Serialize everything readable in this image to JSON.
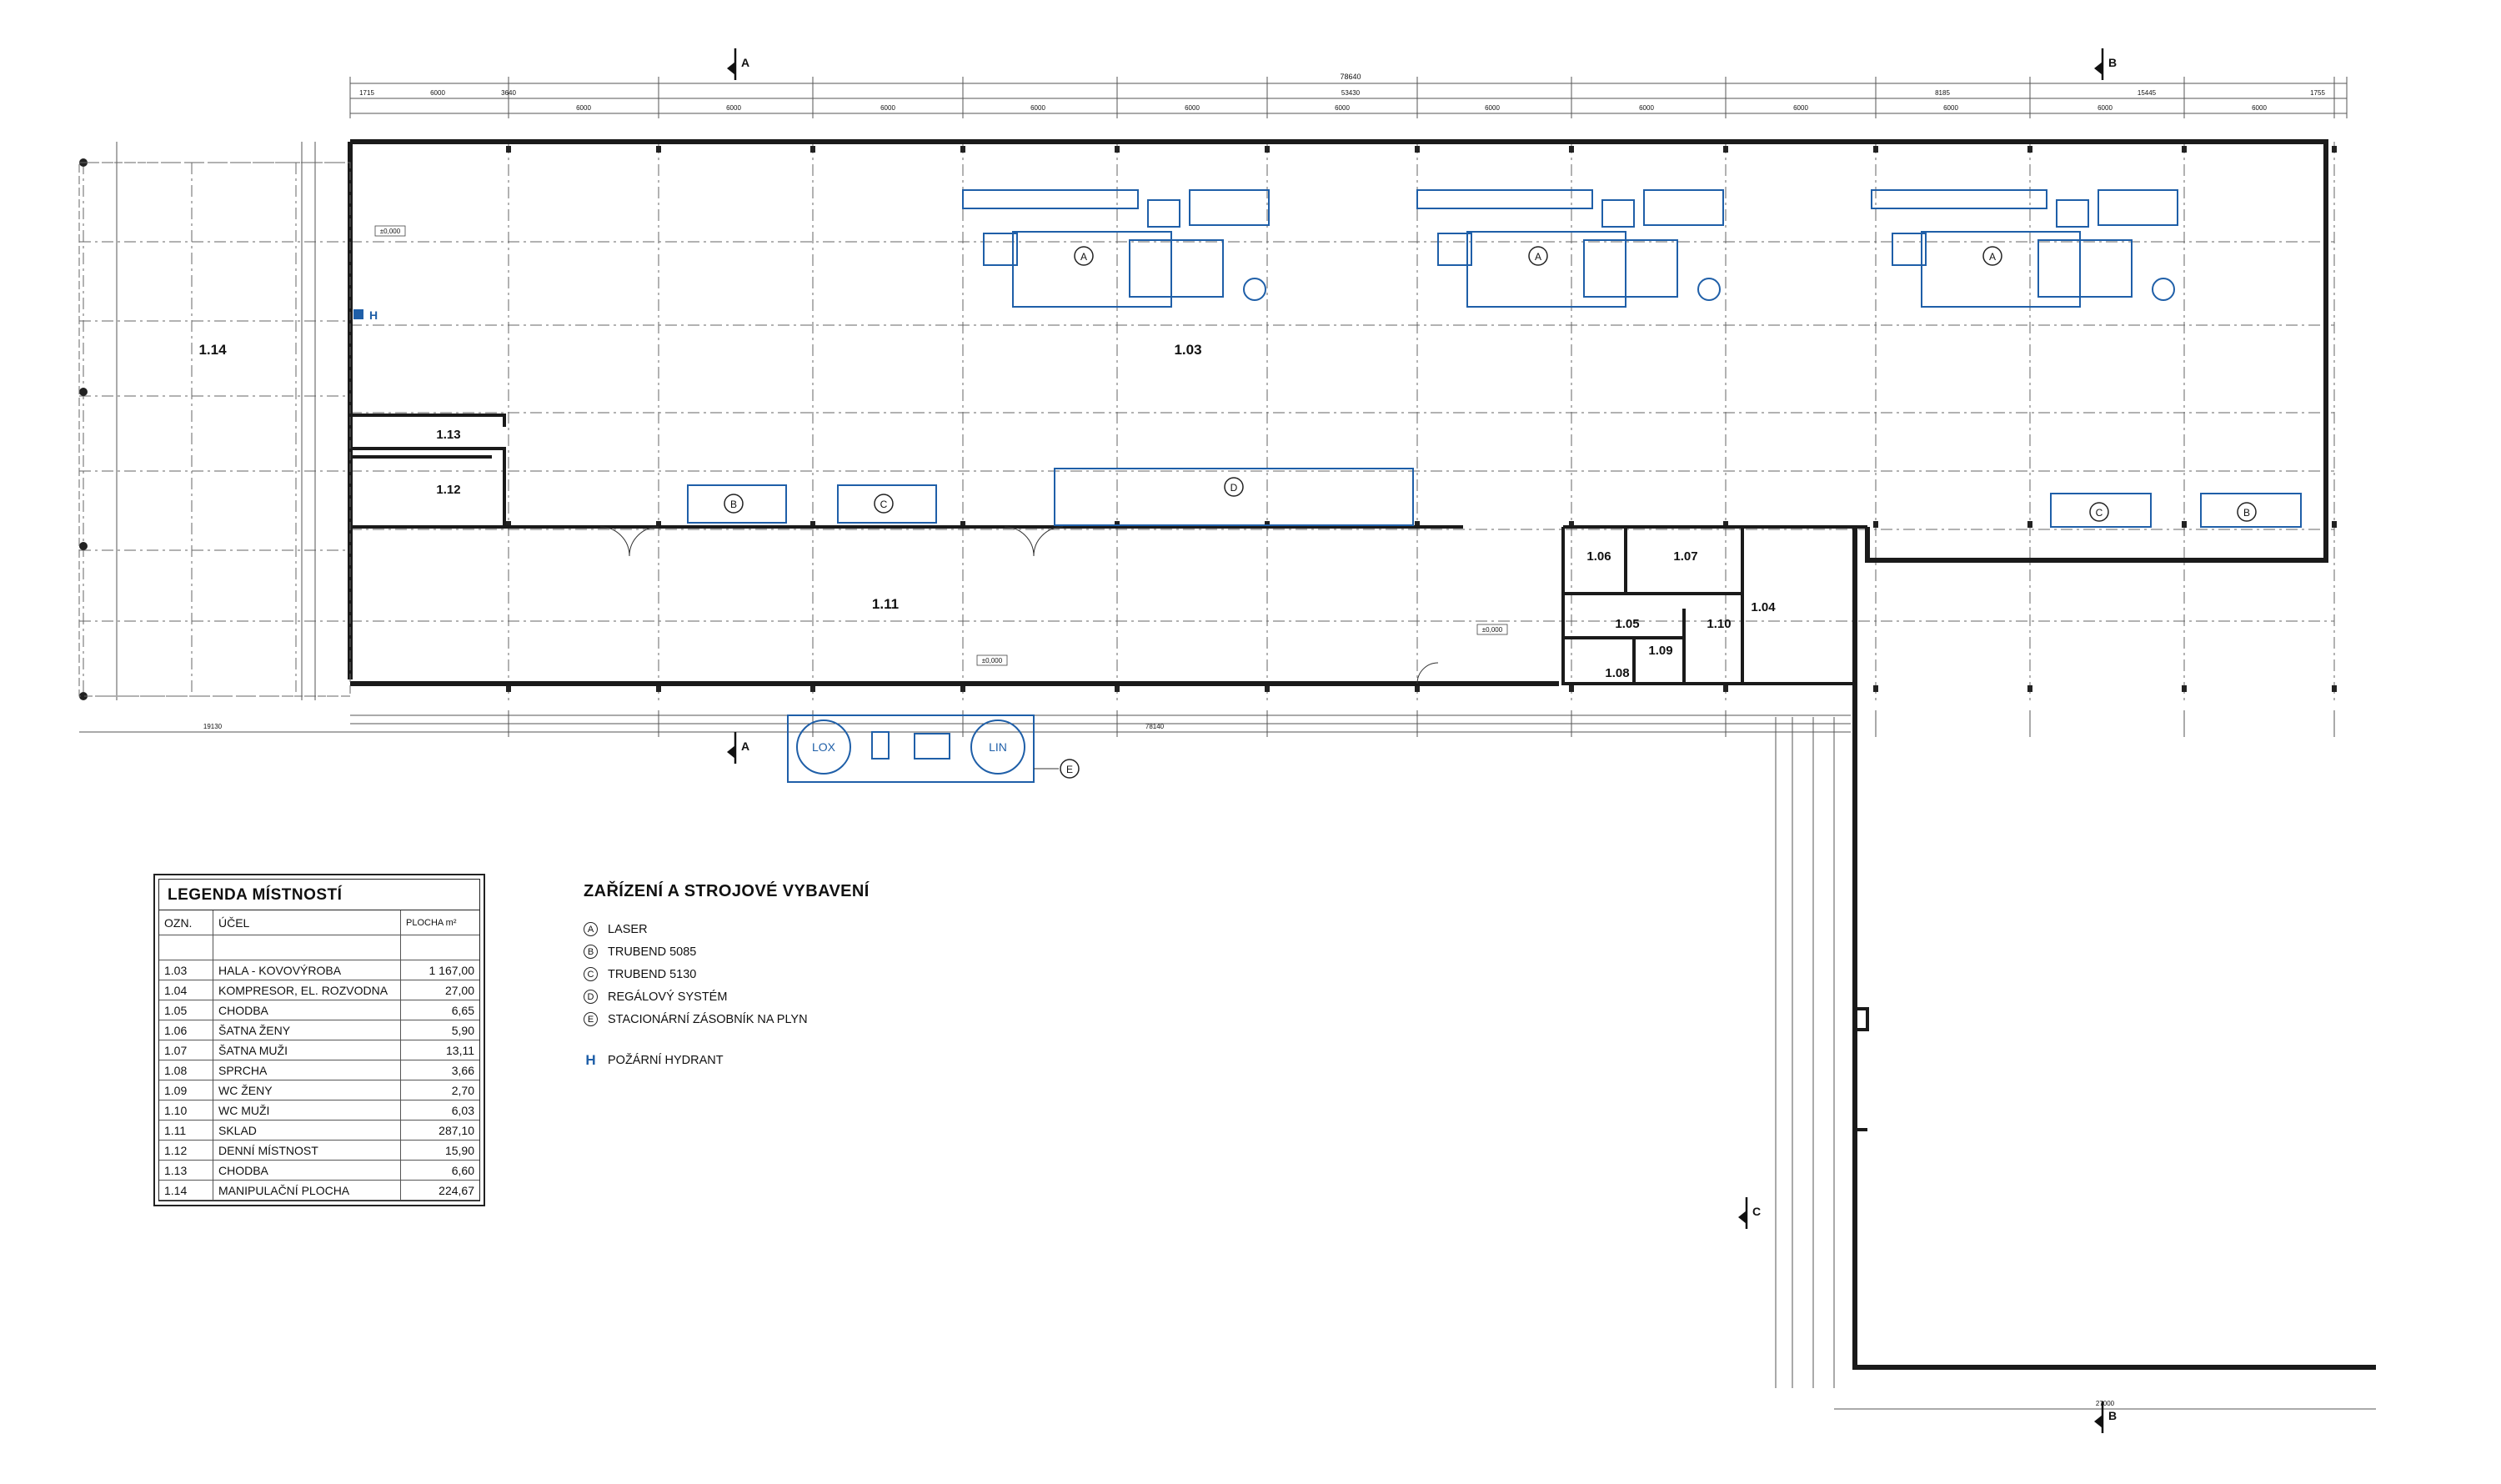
{
  "rooms": [
    {
      "id": "1.03",
      "name": "HALA - KOVOVÝROBA",
      "area": "1 167,00"
    },
    {
      "id": "1.04",
      "name": "KOMPRESOR, EL. ROZVODNA",
      "area": "27,00"
    },
    {
      "id": "1.05",
      "name": "CHODBA",
      "area": "6,65"
    },
    {
      "id": "1.06",
      "name": "ŠATNA ŽENY",
      "area": "5,90"
    },
    {
      "id": "1.07",
      "name": "ŠATNA MUŽI",
      "area": "13,11"
    },
    {
      "id": "1.08",
      "name": "SPRCHA",
      "area": "3,66"
    },
    {
      "id": "1.09",
      "name": "WC ŽENY",
      "area": "2,70"
    },
    {
      "id": "1.10",
      "name": "WC MUŽI",
      "area": "6,03"
    },
    {
      "id": "1.11",
      "name": "SKLAD",
      "area": "287,10"
    },
    {
      "id": "1.12",
      "name": "DENNÍ MÍSTNOST",
      "area": "15,90"
    },
    {
      "id": "1.13",
      "name": "CHODBA",
      "area": "6,60"
    },
    {
      "id": "1.14",
      "name": "MANIPULAČNÍ PLOCHA",
      "area": "224,67"
    }
  ],
  "legend": {
    "title": "LEGENDA MÍSTNOSTÍ",
    "col_id": "OZN.",
    "col_purpose": "ÚČEL",
    "col_area": "PLOCHA m²"
  },
  "equipment": {
    "title": "ZAŘÍZENÍ A STROJOVÉ VYBAVENÍ",
    "items": [
      {
        "letter": "A",
        "label": "LASER"
      },
      {
        "letter": "B",
        "label": "TRUBEND 5085"
      },
      {
        "letter": "C",
        "label": "TRUBEND 5130"
      },
      {
        "letter": "D",
        "label": "REGÁLOVÝ SYSTÉM"
      },
      {
        "letter": "E",
        "label": "STACIONÁRNÍ ZÁSOBNÍK NA PLYN"
      }
    ],
    "hydrant_symbol": "H",
    "hydrant_label": "POŽÁRNÍ HYDRANT"
  },
  "tanks": {
    "lox": "LOX",
    "lin": "LIN"
  },
  "sections": {
    "a": "A",
    "b": "B",
    "c": "C"
  },
  "dimensions": {
    "overall_top": "78640",
    "top_chain": [
      "1715",
      "6000",
      "3640",
      "53430",
      "8185",
      "15445",
      "1755"
    ],
    "grid_spacing": "6000",
    "bottom_left": "19130",
    "hall_width": "78140",
    "wing_width": "27000"
  },
  "levels": {
    "floor": "±0,000"
  },
  "colors": {
    "equipment": "#1f5fa8",
    "wall": "#1a1a1a",
    "grid": "#444444"
  }
}
